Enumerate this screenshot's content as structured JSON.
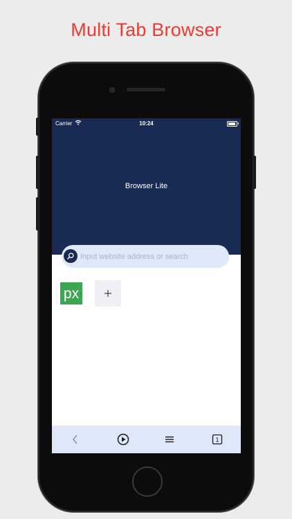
{
  "headline": "Multi Tab Browser",
  "status_bar": {
    "carrier": "Carrier",
    "time": "10:24"
  },
  "app": {
    "title": "Browser Lite"
  },
  "search": {
    "placeholder": "Input website address or search"
  },
  "quick_links": [
    {
      "name": "pixiv",
      "logo_text": "px",
      "color": "#3ea652"
    }
  ],
  "add_tile": {
    "icon": "plus-icon"
  },
  "toolbar": {
    "buttons": [
      "back-icon",
      "play-circle-icon",
      "menu-icon",
      "tabs-count-icon"
    ],
    "tab_count": "1"
  },
  "colors": {
    "headline": "#ea3b34",
    "hero_background": "#192a54",
    "search_background": "#dfe8f8",
    "toolbar_background": "#dfe8f8"
  }
}
